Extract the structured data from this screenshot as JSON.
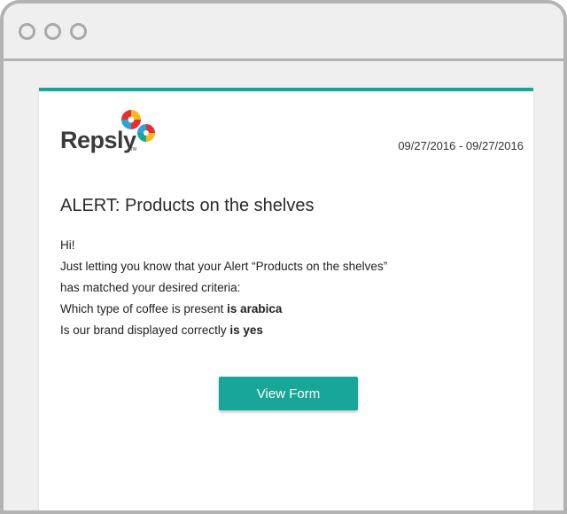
{
  "logo": {
    "text": "Repsly",
    "tm": "TM",
    "colors": [
      "#e52e2d",
      "#f6b81e",
      "#2ba3dd",
      "#1aa597"
    ]
  },
  "email": {
    "date_range": "09/27/2016 - 09/27/2016",
    "title": "ALERT: Products on the shelves",
    "greeting": "Hi!",
    "line1": "Just letting you know that your Alert  “Products on the shelves”",
    "line2": "has matched your desired criteria:",
    "criteria": [
      {
        "question": "Which type of coffee is present ",
        "answer": "is arabica"
      },
      {
        "question": "Is our brand displayed correctly ",
        "answer": "is yes"
      }
    ],
    "button_label": "View Form",
    "accent_color": "#1aa597"
  }
}
